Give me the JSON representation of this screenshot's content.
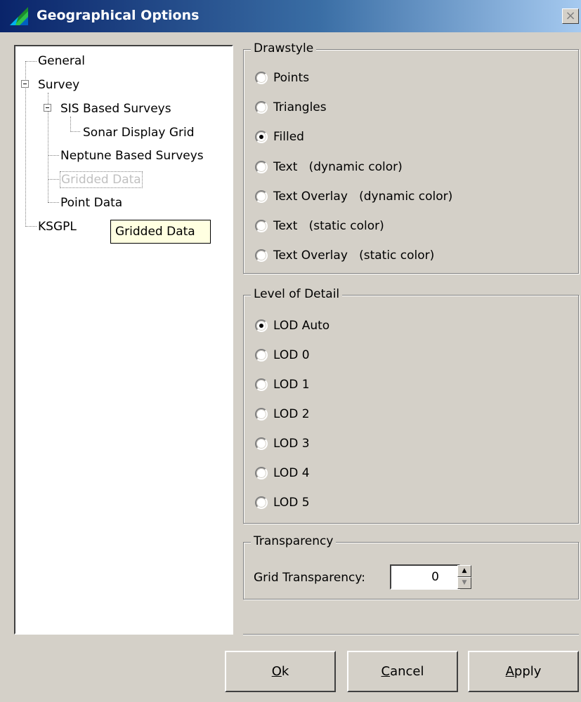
{
  "window": {
    "title": "Geographical Options",
    "close_glyph": "×",
    "icon": "globe-app-icon"
  },
  "tree": {
    "items": [
      {
        "label": "General"
      },
      {
        "label": "Survey"
      },
      {
        "label": "SIS Based Surveys"
      },
      {
        "label": "Sonar Display Grid"
      },
      {
        "label": "Neptune Based Surveys"
      },
      {
        "label": "Gridded Data",
        "selected": true
      },
      {
        "label": "Point Data"
      },
      {
        "label": "KSGPL"
      }
    ],
    "tooltip": "Gridded Data"
  },
  "drawstyle": {
    "legend": "Drawstyle",
    "options": [
      {
        "label": "Points",
        "checked": false
      },
      {
        "label": "Triangles",
        "checked": false
      },
      {
        "label": "Filled",
        "checked": true
      },
      {
        "label": "Text   (dynamic color)",
        "checked": false
      },
      {
        "label": "Text Overlay   (dynamic color)",
        "checked": false
      },
      {
        "label": "Text   (static color)",
        "checked": false
      },
      {
        "label": "Text Overlay   (static color)",
        "checked": false
      }
    ]
  },
  "level_of_detail": {
    "legend": "Level of Detail",
    "options": [
      {
        "label": "LOD Auto",
        "checked": true
      },
      {
        "label": "LOD 0",
        "checked": false
      },
      {
        "label": "LOD 1",
        "checked": false
      },
      {
        "label": "LOD 2",
        "checked": false
      },
      {
        "label": "LOD 3",
        "checked": false
      },
      {
        "label": "LOD 4",
        "checked": false
      },
      {
        "label": "LOD 5",
        "checked": false
      }
    ]
  },
  "transparency": {
    "legend": "Transparency",
    "label": "Grid Transparency:",
    "value": "0"
  },
  "buttons": {
    "ok": {
      "mnemonic": "O",
      "rest": "k"
    },
    "cancel": {
      "mnemonic": "C",
      "rest": "ancel"
    },
    "apply": {
      "mnemonic": "A",
      "rest": "pply"
    }
  }
}
